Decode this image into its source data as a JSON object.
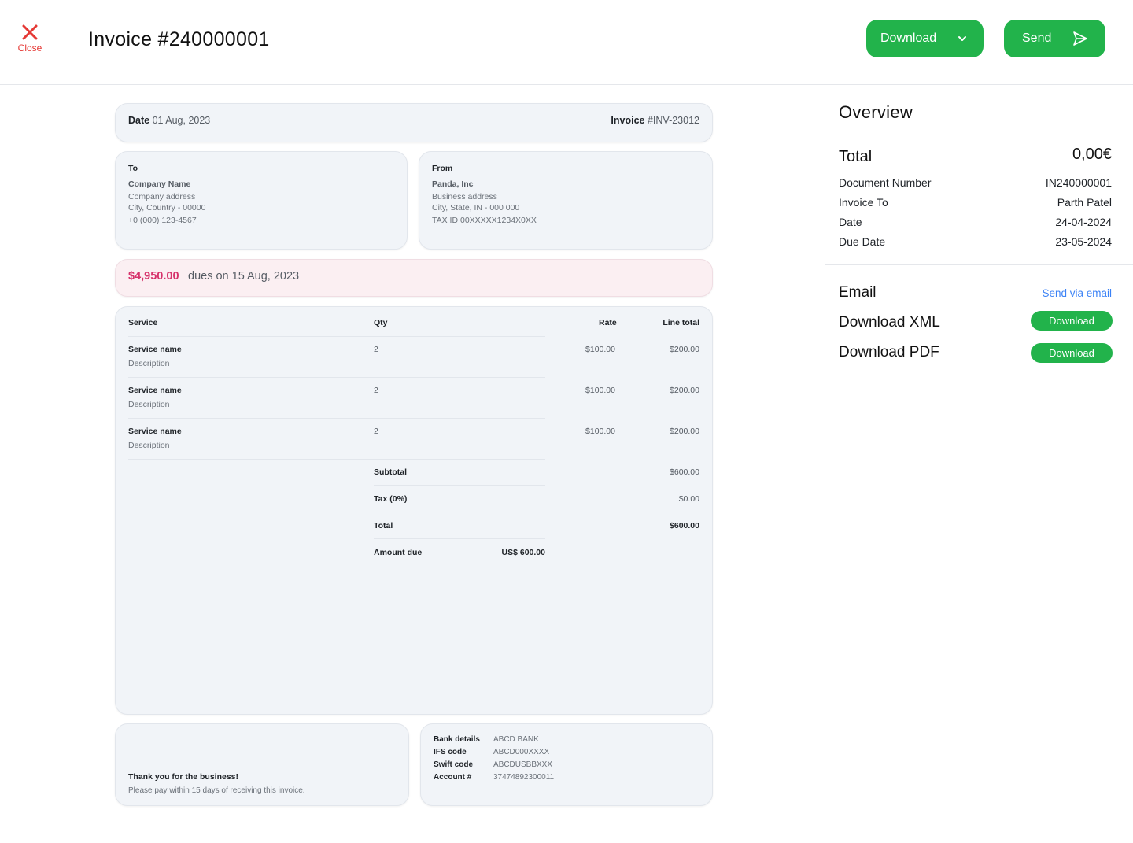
{
  "header": {
    "close_label": "Close",
    "title": "Invoice #240000001",
    "download_label": "Download",
    "send_label": "Send"
  },
  "invoice": {
    "date_label": "Date",
    "date_value": "01 Aug, 2023",
    "invoice_label": "Invoice",
    "invoice_value": "#INV-23012",
    "to": {
      "title": "To",
      "name": "Company Name",
      "address": "Company address",
      "city": "City, Country - 00000",
      "phone": "+0 (000) 123-4567"
    },
    "from": {
      "title": "From",
      "name": "Panda, Inc",
      "address": "Business address",
      "city": "City, State, IN - 000 000",
      "tax": "TAX ID 00XXXXX1234X0XX"
    },
    "due": {
      "amount": "$4,950.00",
      "text": "dues on 15 Aug, 2023"
    },
    "table": {
      "headers": {
        "service": "Service",
        "qty": "Qty",
        "rate": "Rate",
        "line_total": "Line total"
      },
      "rows": [
        {
          "name": "Service name",
          "desc": "Description",
          "qty": "2",
          "rate": "$100.00",
          "total": "$200.00"
        },
        {
          "name": "Service name",
          "desc": "Description",
          "qty": "2",
          "rate": "$100.00",
          "total": "$200.00"
        },
        {
          "name": "Service name",
          "desc": "Description",
          "qty": "2",
          "rate": "$100.00",
          "total": "$200.00"
        }
      ],
      "subtotal_label": "Subtotal",
      "subtotal_value": "$600.00",
      "tax_label": "Tax (0%)",
      "tax_value": "$0.00",
      "total_label": "Total",
      "total_value": "$600.00",
      "amount_due_label": "Amount due",
      "amount_due_value": "US$ 600.00"
    },
    "thanks": {
      "title": "Thank you for the business!",
      "subtitle": "Please pay within 15 days of receiving this invoice."
    },
    "bank": [
      {
        "key": "Bank details",
        "value": "ABCD BANK"
      },
      {
        "key": "IFS code",
        "value": "ABCD000XXXX"
      },
      {
        "key": "Swift code",
        "value": "ABCDUSBBXXX"
      },
      {
        "key": "Account #",
        "value": "37474892300011"
      }
    ]
  },
  "overview": {
    "title": "Overview",
    "total_label": "Total",
    "total_value": "0,00€",
    "fields": [
      {
        "key": "Document Number",
        "value": "IN240000001"
      },
      {
        "key": "Invoice To",
        "value": "Parth Patel"
      },
      {
        "key": "Date",
        "value": "24-04-2024"
      },
      {
        "key": "Due Date",
        "value": "23-05-2024"
      }
    ],
    "email_label": "Email",
    "email_link": "Send via email",
    "xml_label": "Download XML",
    "xml_button": "Download",
    "pdf_label": "Download PDF",
    "pdf_button": "Download"
  },
  "colors": {
    "accent_green": "#22b34b",
    "close_red": "#e53935",
    "due_pink": "#d6336c",
    "link_blue": "#3b82f6"
  }
}
